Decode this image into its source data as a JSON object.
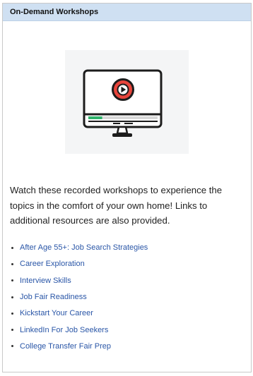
{
  "panel": {
    "title": "On-Demand Workshops",
    "header_color": "#cfe0f2"
  },
  "hero": {
    "icon": "video-monitor-play-icon",
    "accent": "#e8453c",
    "progress": 0.2
  },
  "intro": "Watch these recorded workshops to experience the topics in the comfort of your own home! Links to additional resources are also provided.",
  "links": [
    "After Age 55+: Job Search Strategies",
    "Career Exploration",
    "Interview Skills",
    "Job Fair Readiness",
    "Kickstart Your Career",
    "LinkedIn For Job Seekers",
    "College Transfer Fair Prep"
  ],
  "link_color": "#2a56a7"
}
